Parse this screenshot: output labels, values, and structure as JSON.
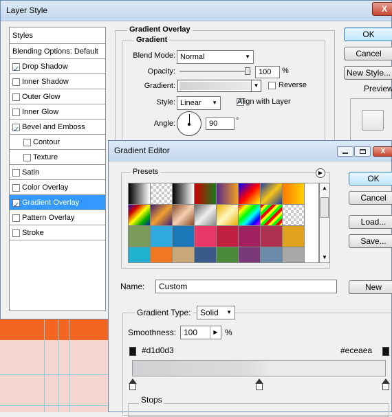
{
  "layer_style": {
    "title": "Layer Style",
    "close_glyph": "X",
    "styles_header": "Styles",
    "items": [
      {
        "label": "Blending Options: Default",
        "checkbox": false,
        "checked": false,
        "indent": false,
        "selected": false
      },
      {
        "label": "Drop Shadow",
        "checkbox": true,
        "checked": true,
        "indent": false,
        "selected": false
      },
      {
        "label": "Inner Shadow",
        "checkbox": true,
        "checked": false,
        "indent": false,
        "selected": false
      },
      {
        "label": "Outer Glow",
        "checkbox": true,
        "checked": false,
        "indent": false,
        "selected": false
      },
      {
        "label": "Inner Glow",
        "checkbox": true,
        "checked": false,
        "indent": false,
        "selected": false
      },
      {
        "label": "Bevel and Emboss",
        "checkbox": true,
        "checked": true,
        "indent": false,
        "selected": false
      },
      {
        "label": "Contour",
        "checkbox": true,
        "checked": false,
        "indent": true,
        "selected": false
      },
      {
        "label": "Texture",
        "checkbox": true,
        "checked": false,
        "indent": true,
        "selected": false
      },
      {
        "label": "Satin",
        "checkbox": true,
        "checked": false,
        "indent": false,
        "selected": false
      },
      {
        "label": "Color Overlay",
        "checkbox": true,
        "checked": false,
        "indent": false,
        "selected": false
      },
      {
        "label": "Gradient Overlay",
        "checkbox": true,
        "checked": true,
        "indent": false,
        "selected": true
      },
      {
        "label": "Pattern Overlay",
        "checkbox": true,
        "checked": false,
        "indent": false,
        "selected": false
      },
      {
        "label": "Stroke",
        "checkbox": true,
        "checked": false,
        "indent": false,
        "selected": false
      }
    ],
    "section_title": "Gradient Overlay",
    "subsection_title": "Gradient",
    "blend_mode_label": "Blend Mode:",
    "blend_mode_value": "Normal",
    "opacity_label": "Opacity:",
    "opacity_value": "100",
    "opacity_unit": "%",
    "gradient_label": "Gradient:",
    "reverse_label": "Reverse",
    "style_label": "Style:",
    "style_value": "Linear",
    "align_label": "Align with Layer",
    "angle_label": "Angle:",
    "angle_value": "90",
    "angle_unit": "°",
    "ok": "OK",
    "cancel": "Cancel",
    "new_style": "New Style...",
    "preview": "Preview"
  },
  "gradient_editor": {
    "title": "Gradient Editor",
    "presets_label": "Presets",
    "ok": "OK",
    "cancel": "Cancel",
    "load": "Load...",
    "save": "Save...",
    "name_label": "Name:",
    "name_value": "Custom",
    "new_button": "New",
    "gradient_type_label": "Gradient Type:",
    "gradient_type_value": "Solid",
    "smoothness_label": "Smoothness:",
    "smoothness_value": "100",
    "smoothness_unit": "%",
    "left_color": "#d1d0d3",
    "right_color": "#eceaea",
    "stops_label": "Stops"
  }
}
